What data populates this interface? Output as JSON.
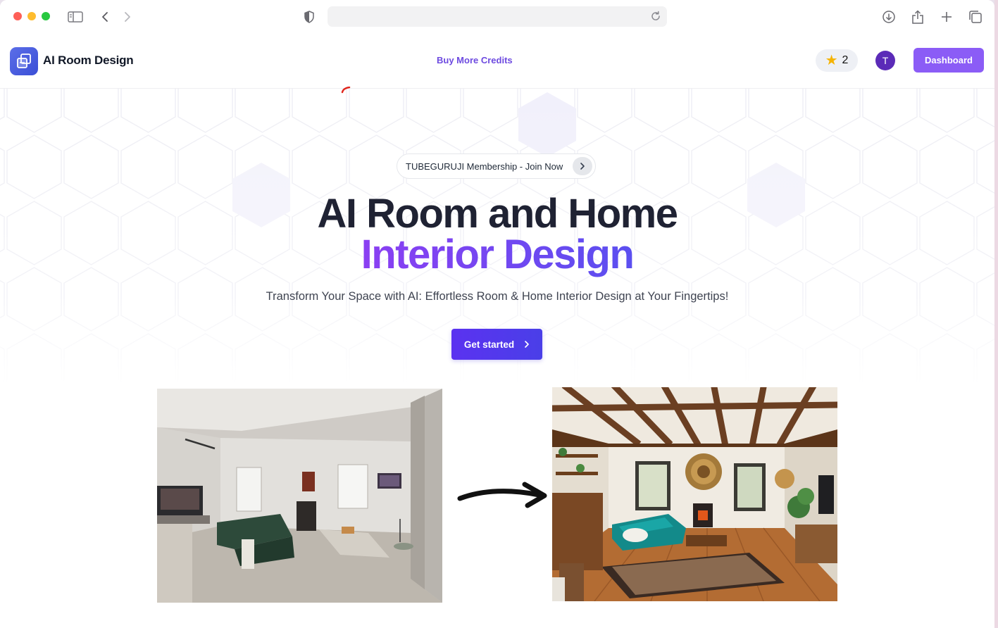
{
  "browser": {
    "controls": [
      "close",
      "minimize",
      "zoom"
    ],
    "icons": [
      "sidebar-icon",
      "back-icon",
      "forward-icon",
      "shield-icon",
      "reload-icon",
      "download-icon",
      "share-icon",
      "new-tab-icon",
      "tabs-overview-icon"
    ],
    "address": ""
  },
  "nav": {
    "brand": "AI Room Design",
    "link": "Buy More Credits",
    "credits": "2",
    "avatar_initial": "T",
    "dashboard_label": "Dashboard"
  },
  "hero": {
    "badge_text": "TUBEGURUJI Membership - Join Now",
    "title_line1": "AI Room and Home",
    "title_line2": "Interior Design",
    "subtitle": "Transform Your Space with AI: Effortless Room & Home Interior Design at Your Fingertips!",
    "cta_label": "Get started"
  },
  "colors": {
    "accent": "#6d4ae0",
    "cta": "#5b32f0",
    "dashboard": "#8b5cf6",
    "title": "#1f2233"
  }
}
